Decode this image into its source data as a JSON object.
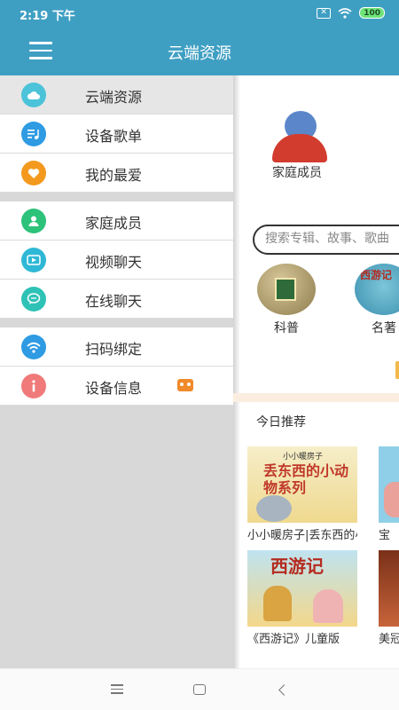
{
  "status": {
    "time": "2:19 下午",
    "battery": "100"
  },
  "appbar": {
    "title": "云端资源"
  },
  "drawer": {
    "groups": [
      [
        {
          "label": "云端资源",
          "icon": "cloud-icon",
          "color": "#4cc3d9",
          "active": true
        },
        {
          "label": "设备歌单",
          "icon": "playlist-icon",
          "color": "#2e9be3"
        },
        {
          "label": "我的最爱",
          "icon": "heart-icon",
          "color": "#f39a1e"
        }
      ],
      [
        {
          "label": "家庭成员",
          "icon": "user-icon",
          "color": "#2cc27a"
        },
        {
          "label": "视频聊天",
          "icon": "video-icon",
          "color": "#2fb8d6"
        },
        {
          "label": "在线聊天",
          "icon": "chat-icon",
          "color": "#2fc2b6"
        }
      ],
      [
        {
          "label": "扫码绑定",
          "icon": "wifi-icon",
          "color": "#2e9be3"
        },
        {
          "label": "设备信息",
          "icon": "info-icon",
          "color": "#f07a7a"
        }
      ]
    ]
  },
  "main": {
    "family_label": "家庭成员",
    "search_placeholder": "搜索专辑、故事、歌曲",
    "categories": [
      {
        "label": "科普",
        "image_text": "昆虫记"
      },
      {
        "label": "名著",
        "image_text": "西游记"
      }
    ],
    "recommend_title": "今日推荐",
    "cards": [
      {
        "caption": "小小暖房子|丢东西的小动物系列",
        "sub": "小小暖房子",
        "title": "丢东西的小动物系列"
      },
      {
        "caption": "《西游记》儿童版",
        "title": "西游记"
      },
      {
        "caption": "宝"
      },
      {
        "caption": "美冠"
      }
    ]
  }
}
